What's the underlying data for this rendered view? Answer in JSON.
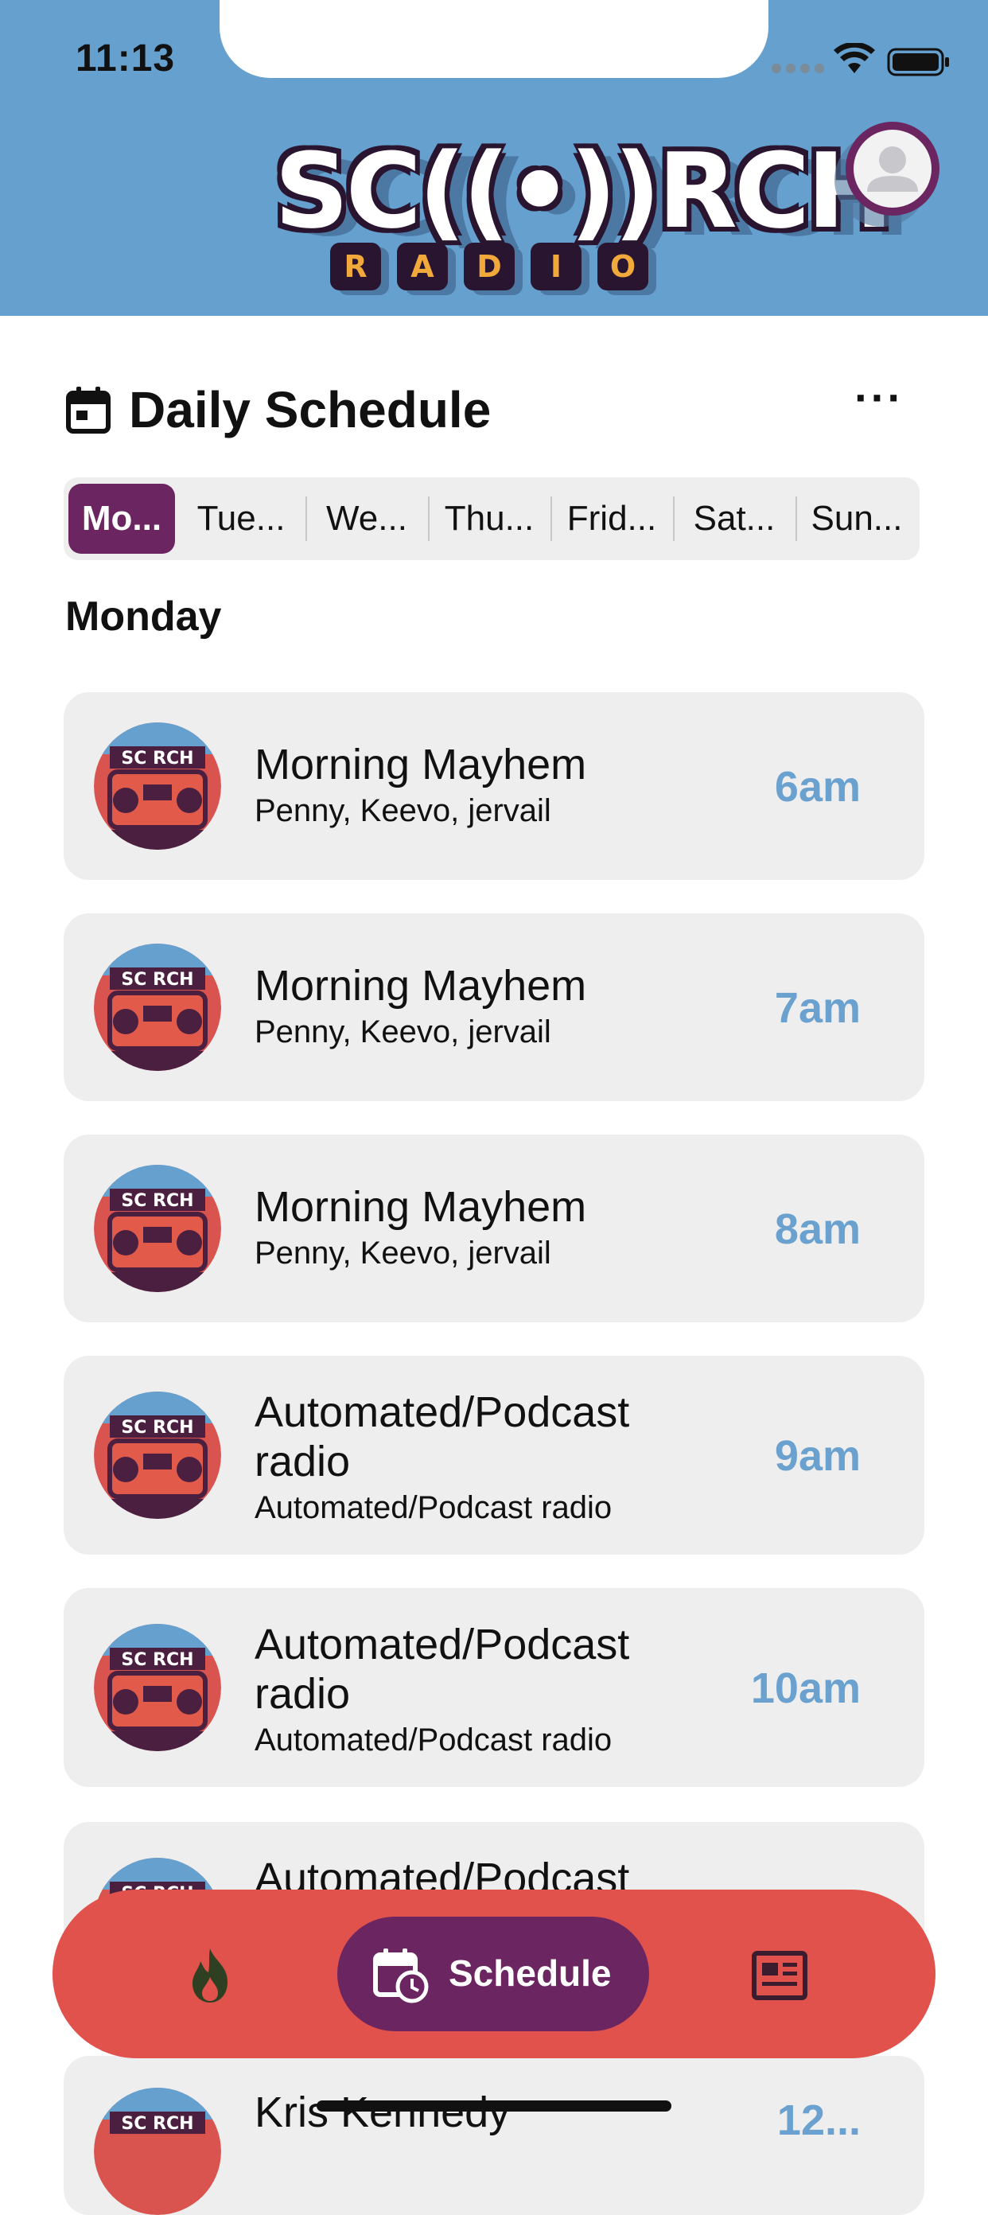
{
  "status_bar": {
    "time": "11:13"
  },
  "header": {
    "logo_main": "SC((•))RCH",
    "logo_sub": [
      "R",
      "A",
      "D",
      "I",
      "O"
    ],
    "accent": "#65a0ce"
  },
  "section": {
    "title": "Daily Schedule",
    "more": "···"
  },
  "days": [
    "Mo...",
    "Tue...",
    "We...",
    "Thu...",
    "Frid...",
    "Sat...",
    "Sun..."
  ],
  "selected_day": "Monday",
  "schedule": [
    {
      "title": "Morning Mayhem",
      "hosts": "Penny, Keevo, jervail",
      "time": "6am"
    },
    {
      "title": "Morning Mayhem",
      "hosts": "Penny, Keevo, jervail",
      "time": "7am"
    },
    {
      "title": "Morning Mayhem",
      "hosts": "Penny, Keevo, jervail",
      "time": "8am"
    },
    {
      "title": "Automated/Podcast radio",
      "hosts": "Automated/Podcast radio",
      "time": "9am"
    },
    {
      "title": "Automated/Podcast radio",
      "hosts": "Automated/Podcast radio",
      "time": "10am"
    },
    {
      "title": "Automated/Podcast",
      "hosts": "",
      "time": ""
    },
    {
      "title": "Kris Kennedy",
      "hosts": "",
      "time": "12..."
    }
  ],
  "tabbar": {
    "fire_icon": "flame-icon",
    "schedule_label": "Schedule",
    "news_icon": "newspaper-icon",
    "bar_color": "#e0524b",
    "active_color": "#6b2560"
  }
}
